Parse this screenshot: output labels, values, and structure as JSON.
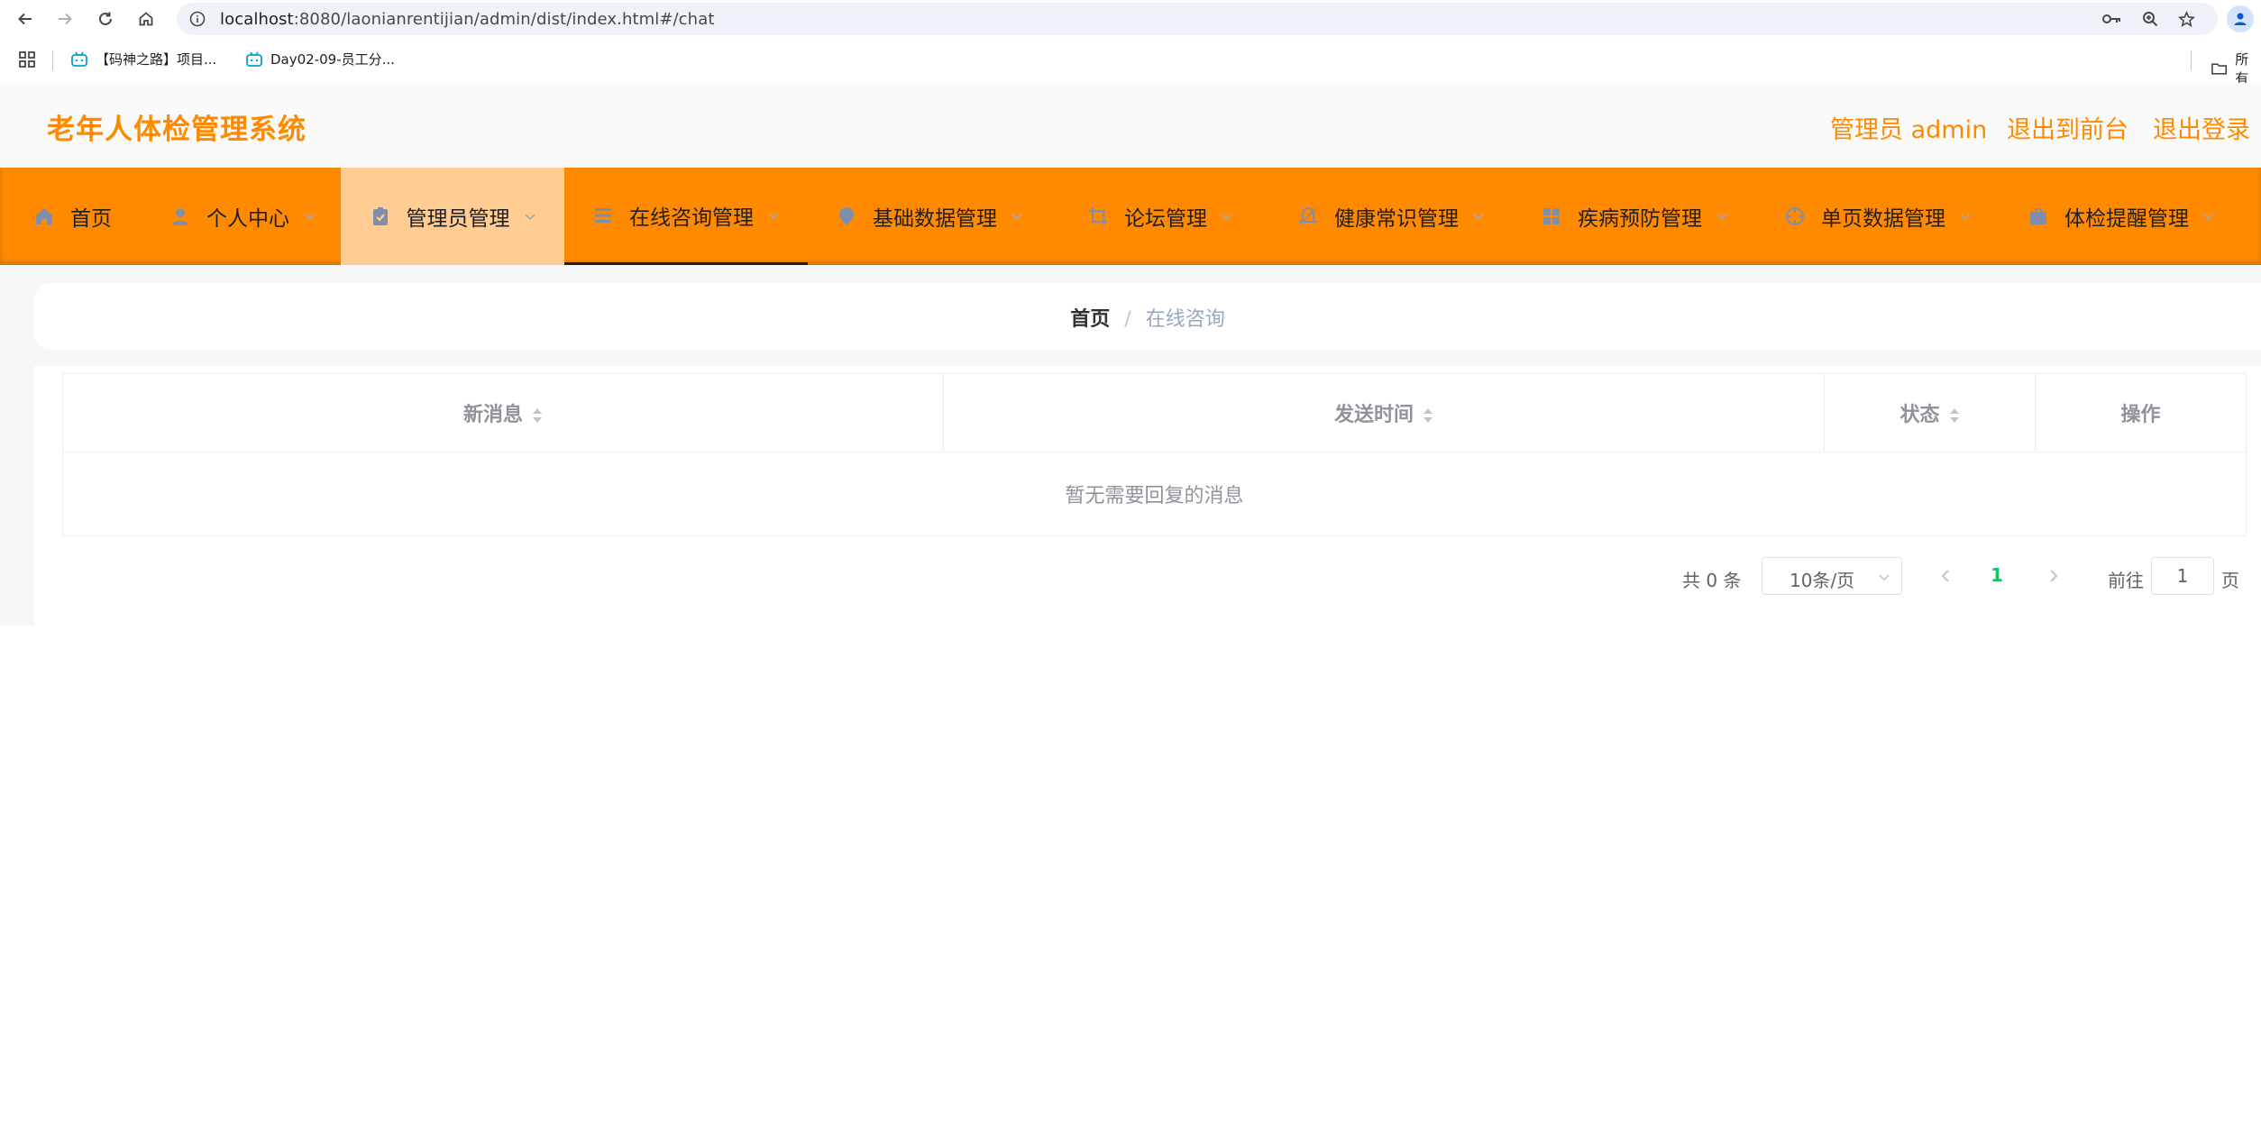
{
  "browser": {
    "url_host": "localhost",
    "url_path": ":8080/laonianrentijian/admin/dist/index.html#/chat",
    "bookmarks": [
      {
        "label": "【码神之路】项目..."
      },
      {
        "label": "Day02-09-员工分..."
      }
    ],
    "bookmarks_right_label": "所有"
  },
  "header": {
    "title": "老年人体检管理系统",
    "user_label": "管理员 admin",
    "to_front_label": "退出到前台",
    "logout_label": "退出登录"
  },
  "menu": {
    "items": [
      {
        "label": "首页",
        "icon": "home-icon"
      },
      {
        "label": "个人中心",
        "icon": "user-icon"
      },
      {
        "label": "管理员管理",
        "icon": "clipboard-check-icon"
      },
      {
        "label": "在线咨询管理",
        "icon": "list-icon"
      },
      {
        "label": "基础数据管理",
        "icon": "location-pin-icon"
      },
      {
        "label": "论坛管理",
        "icon": "crop-icon"
      },
      {
        "label": "健康常识管理",
        "icon": "bell-off-icon"
      },
      {
        "label": "疾病预防管理",
        "icon": "grid-icon"
      },
      {
        "label": "单页数据管理",
        "icon": "compass-icon"
      },
      {
        "label": "体检提醒管理",
        "icon": "briefcase-icon"
      }
    ],
    "highlighted_item": "管理员管理",
    "active_item": "在线咨询管理"
  },
  "breadcrumb": {
    "home": "首页",
    "separator": "/",
    "current": "在线咨询"
  },
  "table": {
    "columns": [
      {
        "label": "新消息",
        "sortable": true
      },
      {
        "label": "发送时间",
        "sortable": true
      },
      {
        "label": "状态",
        "sortable": true
      },
      {
        "label": "操作",
        "sortable": false
      }
    ],
    "rows": [],
    "empty_text": "暂无需要回复的消息"
  },
  "pagination": {
    "total_label": "共 0 条",
    "page_size": "10条/页",
    "current_page": "1",
    "goto_label": "前往",
    "goto_value": "1",
    "page_suffix": "页"
  },
  "colors": {
    "brand": "#ff8a00",
    "menu_highlight": "#ffcc94",
    "page_active": "#19be6b"
  }
}
